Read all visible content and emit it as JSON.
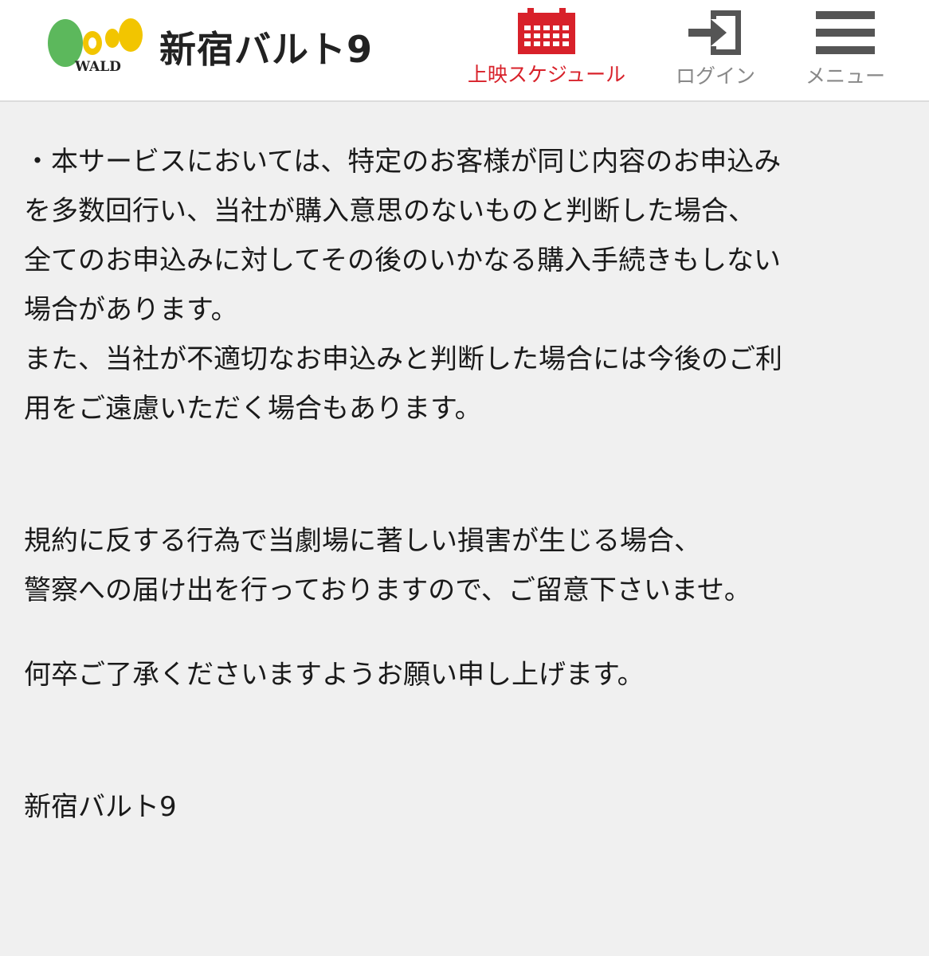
{
  "header": {
    "logo_text": "WALD",
    "site_name": "新宿バルト9",
    "nav": {
      "schedule": "上映スケジュール",
      "login": "ログイン",
      "menu": "メニュー"
    }
  },
  "content": {
    "paragraph_1": "・本サービスにおいては、特定のお客様が同じ内容のお申込み\nを多数回行い、当社が購入意思のないものと判断した場合、\n全てのお申込みに対してその後のいかなる購入手続きもしない\n場合があります。\nまた、当社が不適切なお申込みと判断した場合には今後のご利\n用をご遠慮いただく場合もあります。",
    "paragraph_2": "規約に反する行為で当劇場に著しい損害が生じる場合、\n警察への届け出を行っておりますので、ご留意下さいませ。",
    "paragraph_3": "何卒ご了承くださいますようお願い申し上げます。",
    "signature": "新宿バルト9"
  },
  "colors": {
    "accent_red": "#d8212a",
    "logo_green": "#5cb85c",
    "logo_yellow": "#f2c500",
    "nav_gray": "#888888"
  }
}
